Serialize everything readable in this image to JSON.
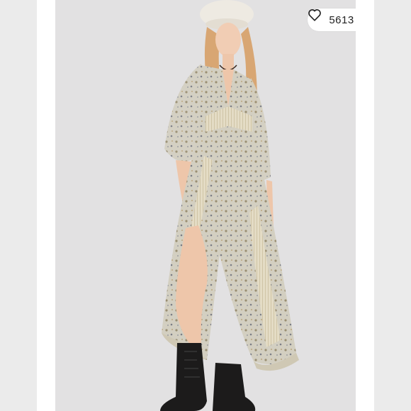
{
  "listing": {
    "like_count": "5613",
    "heart_icon": "heart-outline-icon",
    "image_subject": "model-in-floral-maxi-dress-photo"
  },
  "colors": {
    "background": "#e2e1e2",
    "frame": "#ffffff",
    "dress": "#cfcbbc",
    "boots": "#1c1b1b"
  }
}
